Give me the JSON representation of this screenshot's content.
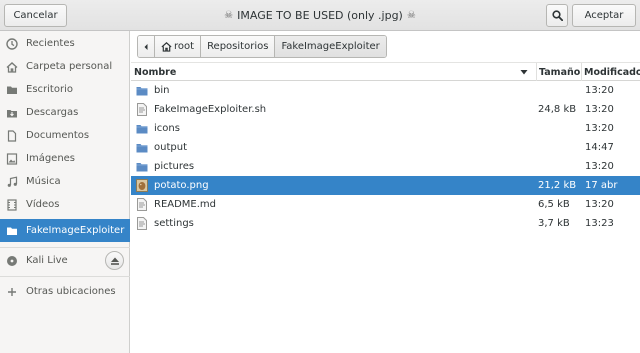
{
  "header": {
    "cancel_label": "Cancelar",
    "title": "IMAGE TO BE USED (only .jpg)",
    "skull_glyph": "☠",
    "accept_label": "Aceptar",
    "search_icon": "search-icon"
  },
  "sidebar": {
    "items": [
      {
        "label": "Recientes",
        "icon": "recent-icon"
      },
      {
        "label": "Carpeta personal",
        "icon": "home-icon"
      },
      {
        "label": "Escritorio",
        "icon": "desktop-icon"
      },
      {
        "label": "Descargas",
        "icon": "download-icon"
      },
      {
        "label": "Documentos",
        "icon": "document-icon"
      },
      {
        "label": "Imágenes",
        "icon": "image-icon"
      },
      {
        "label": "Música",
        "icon": "music-icon"
      },
      {
        "label": "Vídeos",
        "icon": "video-icon"
      },
      {
        "label": "FakeImageExploiter",
        "icon": "folder-icon"
      }
    ],
    "device": {
      "label": "Kali Live",
      "icon": "drive-icon"
    },
    "other": {
      "label": "Otras ubicaciones",
      "icon": "plus-icon"
    }
  },
  "pathbar": {
    "crumbs": [
      "root",
      "Repositorios",
      "FakeImageExploiter"
    ]
  },
  "columns": {
    "name": "Nombre",
    "size": "Tamaño",
    "modified": "Modificado"
  },
  "files": [
    {
      "name": "bin",
      "size": "",
      "modified": "13:20",
      "type": "folder"
    },
    {
      "name": "FakeImageExploiter.sh",
      "size": "24,8 kB",
      "modified": "13:20",
      "type": "script"
    },
    {
      "name": "icons",
      "size": "",
      "modified": "13:20",
      "type": "folder"
    },
    {
      "name": "output",
      "size": "",
      "modified": "14:47",
      "type": "folder"
    },
    {
      "name": "pictures",
      "size": "",
      "modified": "13:20",
      "type": "folder"
    },
    {
      "name": "potato.png",
      "size": "21,2 kB",
      "modified": "17 abr",
      "type": "image"
    },
    {
      "name": "README.md",
      "size": "6,5 kB",
      "modified": "13:20",
      "type": "text"
    },
    {
      "name": "settings",
      "size": "3,7 kB",
      "modified": "13:23",
      "type": "text"
    }
  ],
  "colors": {
    "selection": "#3584c8",
    "folder": "#5b8bc4",
    "sidebar_bg": "#f6f5f4"
  }
}
